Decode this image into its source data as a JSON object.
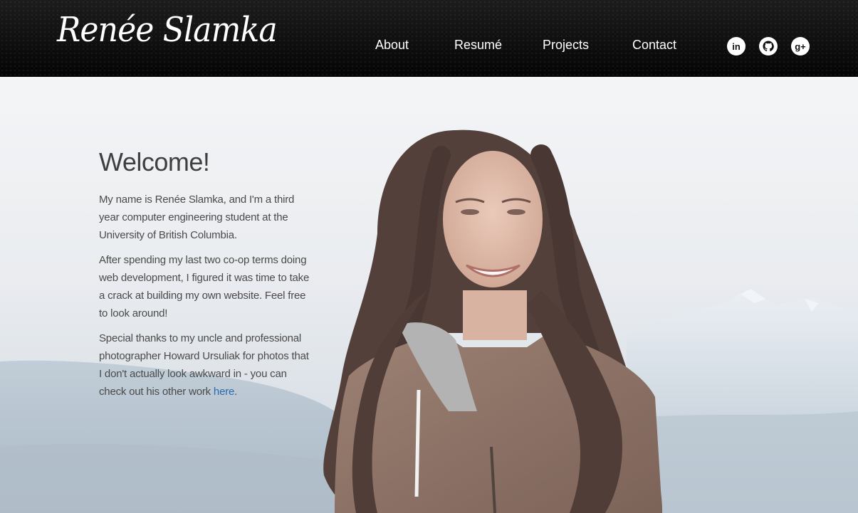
{
  "header": {
    "brand": "Renée Slamka",
    "nav": [
      {
        "label": "About"
      },
      {
        "label": "Resumé"
      },
      {
        "label": "Projects"
      },
      {
        "label": "Contact"
      }
    ],
    "social": [
      {
        "icon": "linkedin-icon",
        "glyph": "in"
      },
      {
        "icon": "github-icon",
        "glyph": "⌂"
      },
      {
        "icon": "google-plus-icon",
        "glyph": "g+"
      }
    ]
  },
  "intro": {
    "title": "Welcome!",
    "p1": "My name is Renée Slamka, and I'm a third year computer engineering student at the University of British Columbia.",
    "p2": "After spending my last two co-op terms doing web development, I figured it was time to take a crack at building my own website. Feel free to look around!",
    "p3_before": "Special thanks to my uncle and professional photographer Howard Ursuliak for photos that I don't actually look awkward in - you can check out his other work ",
    "p3_link": "here",
    "p3_after": "."
  },
  "colors": {
    "link": "#2a6ab0",
    "nav_bg": "#0a0a0a"
  }
}
